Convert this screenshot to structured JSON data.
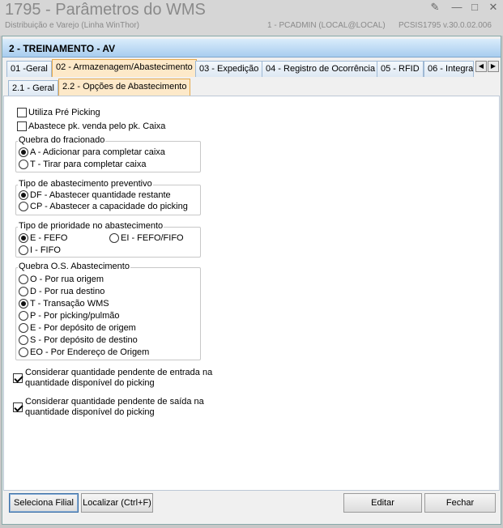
{
  "window": {
    "title": "1795 - Parâmetros do WMS",
    "subtitle": "Distribuição e Varejo (Linha WinThor)",
    "user_info": "1 - PCADMIN (LOCAL@LOCAL)",
    "version": "PCSIS1795  v.30.0.02.006"
  },
  "header": {
    "title": "2 - TREINAMENTO - AV"
  },
  "tabs": [
    {
      "label": "01 -Geral"
    },
    {
      "label": "02 - Armazenagem/Abastecimento"
    },
    {
      "label": "03 - Expedição"
    },
    {
      "label": "04 - Registro de Ocorrência"
    },
    {
      "label": "05 - RFID"
    },
    {
      "label": "06 - Integra"
    }
  ],
  "subtabs": [
    {
      "label": "2.1 - Geral"
    },
    {
      "label": "2.2 - Opções de Abastecimento"
    }
  ],
  "checkboxes": {
    "pre_picking": {
      "label": "Utiliza Pré Picking",
      "checked": false
    },
    "abastece_pk": {
      "label": "Abastece pk. venda pelo pk. Caixa",
      "checked": false
    }
  },
  "quebra_fracionado": {
    "legend": "Quebra do fracionado",
    "options": [
      {
        "label": "A - Adicionar para completar caixa",
        "selected": true
      },
      {
        "label": "T - Tirar para completar caixa",
        "selected": false
      }
    ]
  },
  "tipo_abastecimento": {
    "legend": "Tipo de abastecimento preventivo",
    "options": [
      {
        "label": "DF - Abastecer quantidade restante",
        "selected": true
      },
      {
        "label": "CP - Abastecer a capacidade do picking",
        "selected": false
      }
    ]
  },
  "tipo_prioridade": {
    "legend": "Tipo de prioridade no abastecimento",
    "options": [
      {
        "label": "E - FEFO",
        "selected": true
      },
      {
        "label": "EI - FEFO/FIFO",
        "selected": false
      },
      {
        "label": "I - FIFO",
        "selected": false
      }
    ]
  },
  "quebra_os": {
    "legend": "Quebra O.S. Abastecimento",
    "options": [
      {
        "label": "O - Por rua origem",
        "selected": false
      },
      {
        "label": "D - Por rua destino",
        "selected": false
      },
      {
        "label": "T - Transação WMS",
        "selected": true
      },
      {
        "label": "P - Por picking/pulmão",
        "selected": false
      },
      {
        "label": "E - Por depósito de origem",
        "selected": false
      },
      {
        "label": "S - Por depósito de destino",
        "selected": false
      },
      {
        "label": "EO - Por Endereço de Origem",
        "selected": false
      }
    ]
  },
  "considerar": {
    "entrada": {
      "line1": "Considerar quantidade pendente de entrada na",
      "line2": "quantidade disponível do picking",
      "checked": true
    },
    "saida": {
      "line1": "Considerar quantidade pendente de saída na",
      "line2": "quantidade disponível do picking",
      "checked": true
    }
  },
  "footer": {
    "seleciona_filial": "Seleciona Filial",
    "localizar": "Localizar (Ctrl+F)",
    "editar": "Editar",
    "fechar": "Fechar"
  }
}
